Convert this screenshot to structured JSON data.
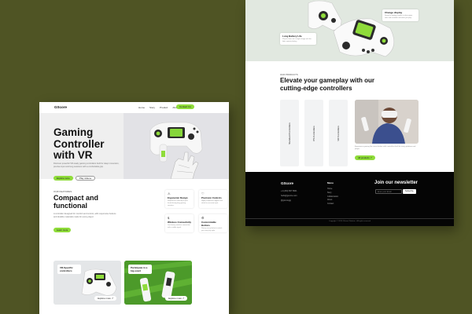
{
  "left_page": {
    "logo": "GScore",
    "nav": [
      "Home",
      "Story",
      "Product",
      "About"
    ],
    "contact_label": "Contact Us",
    "hero": {
      "title": "Gaming Controller with VR",
      "description": "Discover powerful VR-ready gaming controllers built for deep immersion, precise input and long sessions with a comfortable grip.",
      "primary_cta": "Explore more",
      "secondary_cta": "Play video"
    },
    "features": {
      "eyebrow": "OUR FEATURES",
      "title": "Compact and functional",
      "description": "A controller designed for comfort and control, with responsive buttons and durable materials made for every player.",
      "cta": "Learn more",
      "cards": [
        {
          "icon": "⚠",
          "title": "Ergonomic Design",
          "desc": "Shaped to fit naturally in your hands during long gaming sessions."
        },
        {
          "icon": "♡",
          "title": "Precision Controls",
          "desc": "Highly responsive triggers and sticks for accurate input."
        },
        {
          "icon": "$",
          "title": "Wireless Connectivity",
          "desc": "Low latency wireless connection with a stable signal."
        },
        {
          "icon": "⚙",
          "title": "Customizable Buttons",
          "desc": "Remap every button to match your own play style."
        }
      ]
    },
    "promos": [
      {
        "label": "VR-Specific controllers",
        "cta": "Explore more"
      },
      {
        "label": "Participate in a big event",
        "cta": "Explore more"
      }
    ]
  },
  "right_page": {
    "callouts": [
      {
        "title": "Change display",
        "desc": "Swap the display module to show game stats and controller info while you play."
      },
      {
        "title": "Long Battery Life",
        "desc": "Play for hours on a single charge with the high capacity battery."
      }
    ],
    "products": {
      "eyebrow": "OUR PRODUCTS",
      "title": "Elevate your gameplay with our cutting-edge controllers",
      "tabs": [
        "Standard Controllers",
        "PS Controllers",
        "VR Controllers"
      ],
      "photo_caption": "Experience gaming like never before with controllers built for every platform and player.",
      "photo_cta": "All products"
    },
    "footer": {
      "logo": "GScore",
      "contacts": [
        "+1 (234) 567 8901",
        "hello@gscore.com",
        "@gscoregg"
      ],
      "menu_title": "Menu",
      "menu": [
        "Home",
        "Story",
        "Collaboration",
        "About",
        "Contact"
      ],
      "newsletter_title": "Join our newsletter",
      "email_placeholder": "Enter your Email",
      "subscribe": "Subscribe",
      "copyright": "Copyright © 2024 GScore Website · All rights reserved"
    }
  },
  "colors": {
    "background": "#4f5424",
    "accent": "#8fdc3a",
    "footer": "#050505"
  }
}
